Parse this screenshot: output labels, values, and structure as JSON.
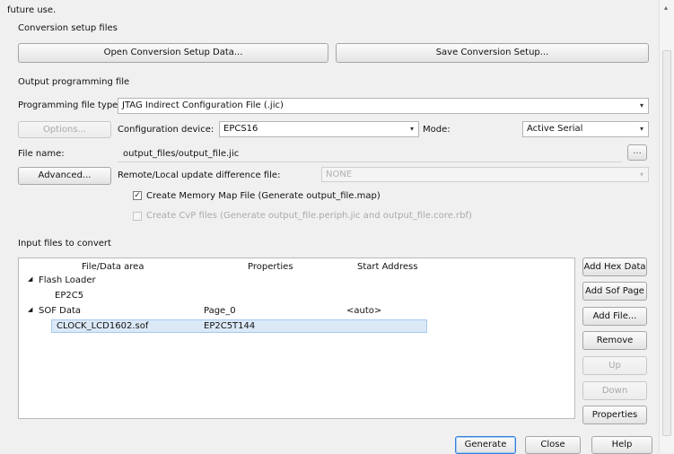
{
  "intro_text": "future use.",
  "conversion_setup": {
    "heading": "Conversion setup files",
    "open_button": "Open Conversion Setup Data...",
    "save_button": "Save Conversion Setup..."
  },
  "output": {
    "heading": "Output programming file",
    "file_type_label": "Programming file type:",
    "file_type_value": "JTAG Indirect Configuration File (.jic)",
    "options_button": "Options...",
    "config_device_label": "Configuration device:",
    "config_device_value": "EPCS16",
    "mode_label": "Mode:",
    "mode_value": "Active Serial",
    "file_name_label": "File name:",
    "file_name_value": "output_files/output_file.jic",
    "browse_button": "...",
    "advanced_button": "Advanced...",
    "remote_label": "Remote/Local update difference file:",
    "remote_value": "NONE",
    "memory_map_label": "Create Memory Map File (Generate output_file.map)",
    "memory_map_checked": true,
    "cvp_label": "Create CvP files (Generate output_file.periph.jic and output_file.core.rbf)",
    "cvp_checked": false
  },
  "input": {
    "heading": "Input files to convert",
    "columns": [
      "File/Data area",
      "Properties",
      "Start Address"
    ],
    "tree": [
      {
        "expander": "◢",
        "label": "Flash Loader",
        "properties": "",
        "address": ""
      },
      {
        "expander": "",
        "label": "EP2C5",
        "properties": "",
        "address": ""
      },
      {
        "expander": "◢",
        "label": "SOF Data",
        "properties": "Page_0",
        "address": "<auto>"
      },
      {
        "expander": "",
        "label": "CLOCK_LCD1602.sof",
        "properties": "EP2C5T144",
        "address": ""
      }
    ],
    "side_buttons": {
      "add_hex": "Add Hex Data",
      "add_sof": "Add Sof Page",
      "add_file": "Add File...",
      "remove": "Remove",
      "up": "Up",
      "down": "Down",
      "properties": "Properties"
    }
  },
  "footer": {
    "generate": "Generate",
    "close": "Close",
    "help": "Help"
  },
  "icons": {
    "dropdown": "▾",
    "scroll_up": "▴",
    "expander": "◢",
    "checkmark": "✓"
  },
  "colors": {
    "window_bg": "#f0f0f0",
    "selection": "#dbe9f7",
    "accent_border": "#3b7dd8"
  }
}
